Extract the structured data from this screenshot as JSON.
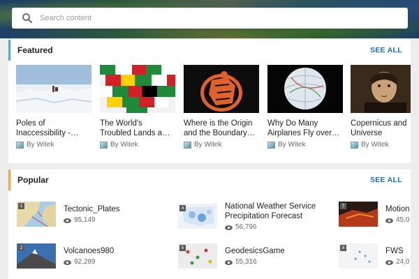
{
  "search": {
    "placeholder": "Search content"
  },
  "featured": {
    "title": "Featured",
    "see_all": "SEE ALL",
    "items": [
      {
        "title": "Poles of Inaccessibility -…",
        "author": "By Witek"
      },
      {
        "title": "The World's Troubled Lands a…",
        "author": "By Witek"
      },
      {
        "title": "Where is the Origin and the Boundary…",
        "author": "By Witek"
      },
      {
        "title": "Why Do Many Airplanes Fly over…",
        "author": "By Witek"
      },
      {
        "title": "Copernicus and Universe",
        "author": "By Witek"
      }
    ]
  },
  "popular": {
    "title": "Popular",
    "see_all": "SEE ALL",
    "items": [
      {
        "rank": "1",
        "name": "Tectonic_Plates",
        "views": "95,149"
      },
      {
        "rank": "4",
        "name": "National Weather Service Precipitation Forecast",
        "views": "56,796"
      },
      {
        "rank": "7",
        "name": "Motion",
        "views": "45,0"
      },
      {
        "rank": "2",
        "name": "Volcanoes980",
        "views": "92,289"
      },
      {
        "rank": "5",
        "name": "GeodesicsGame",
        "views": "55,316"
      },
      {
        "rank": "8",
        "name": "FWS",
        "views": "24,0"
      }
    ]
  }
}
